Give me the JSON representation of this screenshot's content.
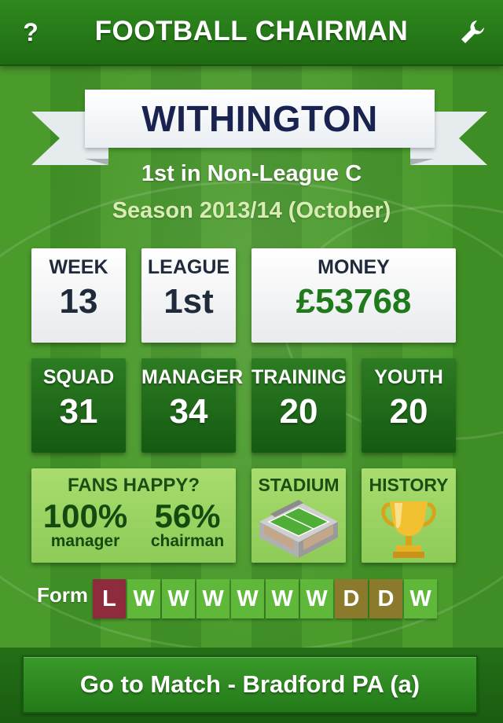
{
  "header": {
    "title": "FOOTBALL CHAIRMAN",
    "help_icon": "help-icon",
    "help_glyph": "?",
    "settings_icon": "wrench-icon"
  },
  "club": {
    "name": "WITHINGTON",
    "position_line": "1st in Non-League C",
    "season_line": "Season 2013/14 (October)"
  },
  "stats_top": {
    "week": {
      "label": "WEEK",
      "value": "13"
    },
    "league": {
      "label": "LEAGUE",
      "value": "1st"
    },
    "money": {
      "label": "MONEY",
      "value": "£53768"
    }
  },
  "stats_mid": {
    "squad": {
      "label": "SQUAD",
      "value": "31"
    },
    "manager": {
      "label": "MANAGER",
      "value": "34"
    },
    "training": {
      "label": "TRAINING",
      "value": "20"
    },
    "youth": {
      "label": "YOUTH",
      "value": "20"
    }
  },
  "fans": {
    "label": "FANS HAPPY?",
    "manager_pct": "100%",
    "manager_label": "manager",
    "chairman_pct": "56%",
    "chairman_label": "chairman"
  },
  "stadium": {
    "label": "STADIUM",
    "icon": "stadium-icon"
  },
  "history": {
    "label": "HISTORY",
    "icon": "trophy-icon"
  },
  "form": {
    "label": "Form",
    "results": [
      "L",
      "W",
      "W",
      "W",
      "W",
      "W",
      "W",
      "D",
      "D",
      "W"
    ]
  },
  "colors": {
    "win": "#5fb83a",
    "draw": "#8c7a2c",
    "loss": "#8e2b3c"
  },
  "action": {
    "match_label": "Go to Match - Bradford PA (a)"
  }
}
